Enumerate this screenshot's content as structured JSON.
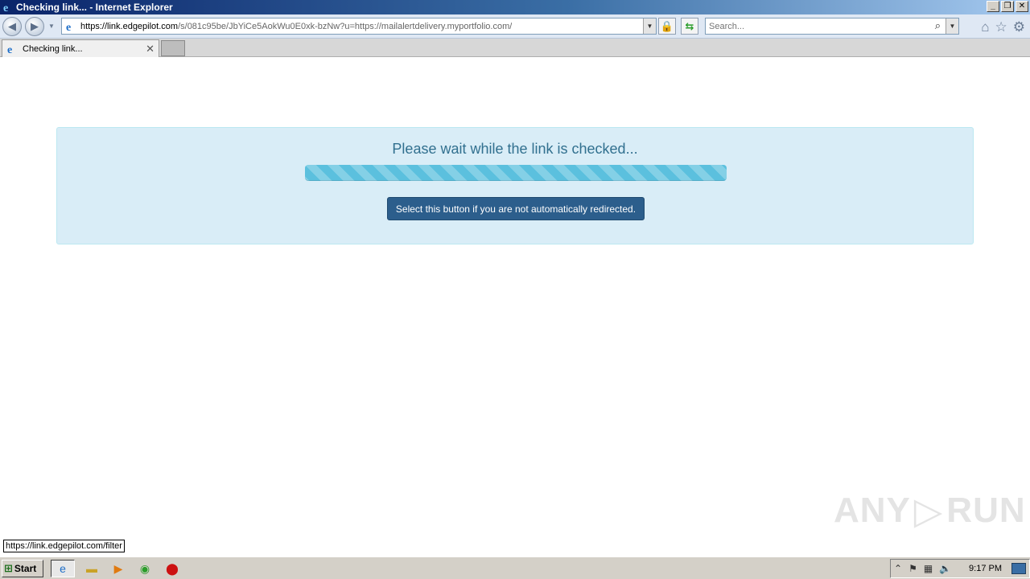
{
  "window": {
    "title": "Checking link... - Internet Explorer",
    "controls": {
      "minimize": "_",
      "restore": "❐",
      "close": "✕"
    }
  },
  "navbar": {
    "back_icon": "back-arrow-icon",
    "forward_icon": "forward-arrow-icon",
    "address": {
      "host_part": "https://link.edgepilot.com",
      "rest_part": "/s/081c95be/JbYiCe5AokWu0E0xk-bzNw?u=https://mailalertdelivery.myportfolio.com/"
    },
    "search": {
      "placeholder": "Search..."
    }
  },
  "tabs": [
    {
      "label": "Checking link...",
      "active": true
    }
  ],
  "page": {
    "message": "Please wait while the link is checked...",
    "progress_percent": 100,
    "redirect_button": "Select this button if you are not automatically redirected.",
    "colors": {
      "alert_bg": "#d9edf7",
      "alert_text": "#31708f",
      "progress": "#5bc0de",
      "button": "#2c5e8c"
    }
  },
  "statusbar": {
    "link": "https://link.edgepilot.com/filter"
  },
  "watermark": {
    "left": "ANY",
    "right": "RUN"
  },
  "taskbar": {
    "start_label": "Start",
    "clock": "9:17 PM",
    "pinned": [
      "internet-explorer-icon",
      "folder-icon",
      "media-player-icon",
      "chrome-icon",
      "opera-icon"
    ]
  }
}
